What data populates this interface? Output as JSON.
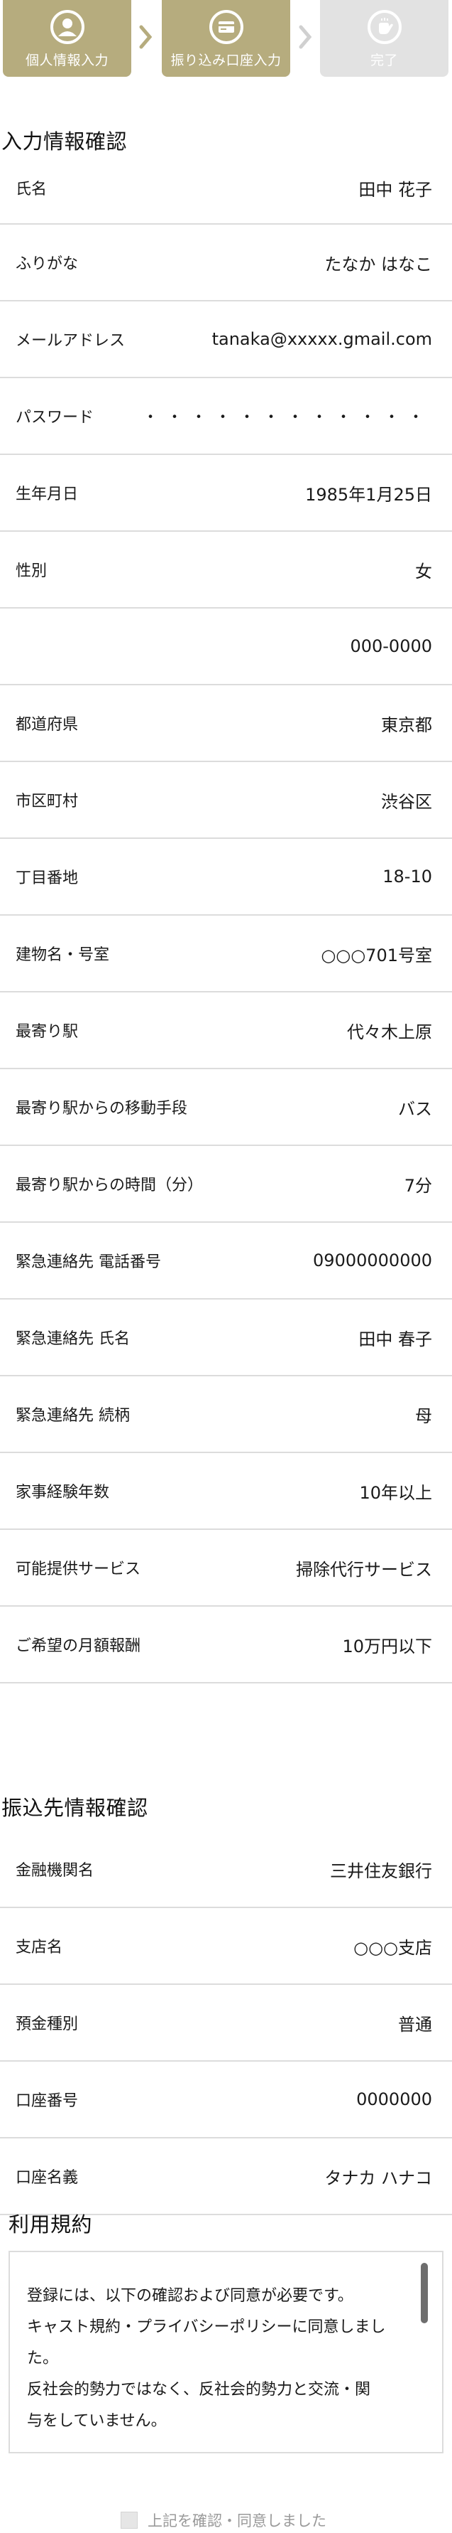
{
  "steps": [
    {
      "label": "個人情報入力",
      "icon": "user-icon",
      "state": "done"
    },
    {
      "label": "振り込み口座入力",
      "icon": "card-icon",
      "state": "done"
    },
    {
      "label": "完了",
      "icon": "hand-icon",
      "state": "inactive"
    }
  ],
  "colors": {
    "step_active": "#b6ac7e",
    "step_inactive": "#e2e2e2",
    "divider": "#dcdcdc"
  },
  "personal": {
    "title": "入力情報確認",
    "rows": [
      {
        "label": "氏名",
        "value": "田中 花子"
      },
      {
        "label": "ふりがな",
        "value": "たなか はなこ"
      },
      {
        "label": "メールアドレス",
        "value": "tanaka@xxxxx.gmail.com"
      },
      {
        "label": "パスワード",
        "value": "・・・・・・・・・・・・"
      },
      {
        "label": "生年月日",
        "value": "1985年1月25日"
      },
      {
        "label": "性別",
        "value": "女"
      },
      {
        "label": "",
        "value": "000-0000"
      },
      {
        "label": "都道府県",
        "value": "東京都"
      },
      {
        "label": "市区町村",
        "value": "渋谷区"
      },
      {
        "label": "丁目番地",
        "value": "18-10"
      },
      {
        "label": "建物名・号室",
        "value": "○○○701号室"
      },
      {
        "label": "最寄り駅",
        "value": "代々木上原"
      },
      {
        "label": "最寄り駅からの移動手段",
        "value": "バス"
      },
      {
        "label": "最寄り駅からの時間（分）",
        "value": "7分"
      },
      {
        "label": "緊急連絡先 電話番号",
        "value": "09000000000"
      },
      {
        "label": "緊急連絡先 氏名",
        "value": "田中 春子"
      },
      {
        "label": "緊急連絡先 続柄",
        "value": "母"
      },
      {
        "label": "家事経験年数",
        "value": "10年以上"
      },
      {
        "label": "可能提供サービス",
        "value": "掃除代行サービス"
      },
      {
        "label": "ご希望の月額報酬",
        "value": "10万円以下"
      }
    ]
  },
  "bank": {
    "title": "振込先情報確認",
    "rows": [
      {
        "label": "金融機関名",
        "value": "三井住友銀行"
      },
      {
        "label": "支店名",
        "value": "○○○支店"
      },
      {
        "label": "預金種別",
        "value": "普通"
      },
      {
        "label": "口座番号",
        "value": "0000000"
      },
      {
        "label": "口座名義",
        "value": "タナカ ハナコ"
      }
    ]
  },
  "terms": {
    "title": "利用規約",
    "lines": [
      "登録には、以下の確認および同意が必要です。",
      "キャスト規約・プライバシーポリシーに同意しまし",
      "た。",
      "反社会的勢力ではなく、反社会的勢力と交流・関",
      "与をしていません。"
    ],
    "agree_label": "上記を確認・同意しました"
  }
}
